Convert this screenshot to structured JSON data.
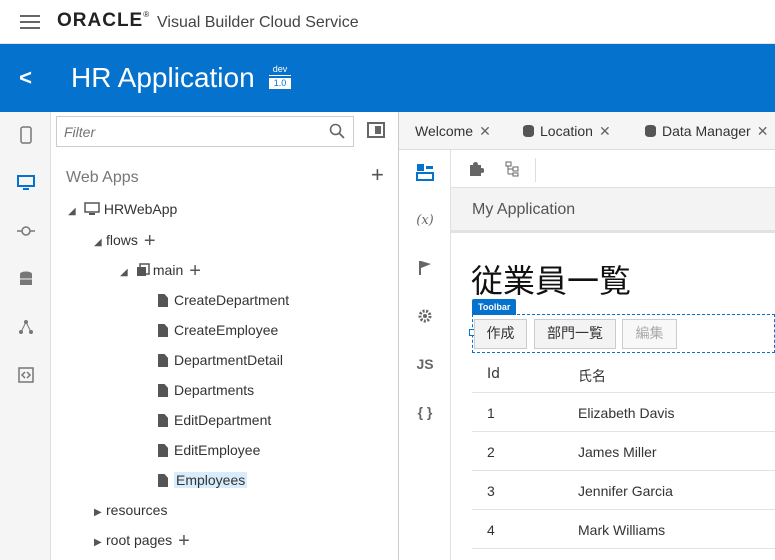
{
  "header": {
    "logo": "ORACLE",
    "service": "Visual Builder Cloud Service"
  },
  "appbar": {
    "back": "<",
    "title": "HR Application",
    "version_top": "dev",
    "version_bottom": "1.0"
  },
  "tree": {
    "filter_placeholder": "Filter",
    "section_title": "Web Apps",
    "nodes": [
      {
        "label": "HRWebApp"
      },
      {
        "label": "flows"
      },
      {
        "label": "main"
      },
      {
        "label": "CreateDepartment"
      },
      {
        "label": "CreateEmployee"
      },
      {
        "label": "DepartmentDetail"
      },
      {
        "label": "Departments"
      },
      {
        "label": "EditDepartment"
      },
      {
        "label": "EditEmployee"
      },
      {
        "label": "Employees"
      },
      {
        "label": "resources"
      },
      {
        "label": "root pages"
      }
    ]
  },
  "tabs": [
    {
      "label": "Welcome"
    },
    {
      "label": "Location"
    },
    {
      "label": "Data Manager"
    }
  ],
  "rail": {
    "expression": "(x)",
    "js": "JS",
    "json": "{ }"
  },
  "canvas": {
    "app_name": "My Application",
    "heading": "従業員一覧",
    "toolbar_badge": "Toolbar",
    "buttons": [
      {
        "label": "作成",
        "disabled": false
      },
      {
        "label": "部門一覧",
        "disabled": false
      },
      {
        "label": "編集",
        "disabled": true
      }
    ],
    "columns": [
      "Id",
      "氏名"
    ],
    "rows": [
      {
        "id": "1",
        "name": "Elizabeth Davis"
      },
      {
        "id": "2",
        "name": "James Miller"
      },
      {
        "id": "3",
        "name": "Jennifer Garcia"
      },
      {
        "id": "4",
        "name": "Mark Williams"
      }
    ]
  },
  "colors": {
    "brand": "#0572ce",
    "selection": "#d9ecfb"
  }
}
